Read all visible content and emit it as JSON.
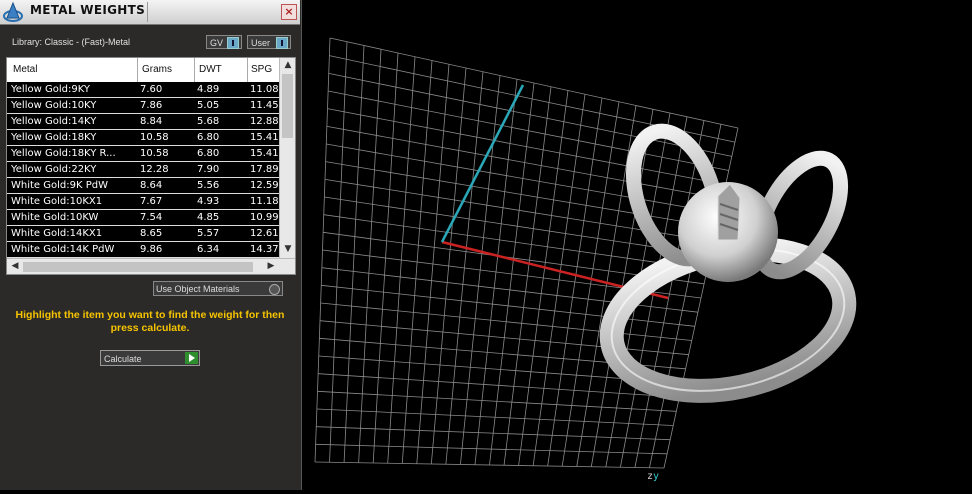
{
  "panel": {
    "title": "METAL WEIGHTS",
    "close": "×",
    "library_label": "Library: Classic - (Fast)-Metal",
    "gv_label": "GV",
    "user_label": "User"
  },
  "table": {
    "columns": [
      "Metal",
      "Grams",
      "DWT",
      "SPG"
    ],
    "rows": [
      {
        "name": "Yellow Gold:9KY",
        "grams": "7.60",
        "dwt": "4.89",
        "spg": "11.08"
      },
      {
        "name": "Yellow Gold:10KY",
        "grams": "7.86",
        "dwt": "5.05",
        "spg": "11.45"
      },
      {
        "name": "Yellow Gold:14KY",
        "grams": "8.84",
        "dwt": "5.68",
        "spg": "12.88"
      },
      {
        "name": "Yellow Gold:18KY",
        "grams": "10.58",
        "dwt": "6.80",
        "spg": "15.41"
      },
      {
        "name": "Yellow Gold:18KY R...",
        "grams": "10.58",
        "dwt": "6.80",
        "spg": "15.41"
      },
      {
        "name": "Yellow Gold:22KY",
        "grams": "12.28",
        "dwt": "7.90",
        "spg": "17.89"
      },
      {
        "name": "White Gold:9K PdW",
        "grams": "8.64",
        "dwt": "5.56",
        "spg": "12.59"
      },
      {
        "name": "White Gold:10KX1",
        "grams": "7.67",
        "dwt": "4.93",
        "spg": "11.18"
      },
      {
        "name": "White Gold:10KW",
        "grams": "7.54",
        "dwt": "4.85",
        "spg": "10.99"
      },
      {
        "name": "White Gold:14KX1",
        "grams": "8.65",
        "dwt": "5.57",
        "spg": "12.61"
      },
      {
        "name": "White Gold:14K PdW",
        "grams": "9.86",
        "dwt": "6.34",
        "spg": "14.37"
      }
    ]
  },
  "use_object_materials": "Use Object Materials",
  "instructions": "Highlight the item you want to find the weight for then press calculate.",
  "calculate_label": "Calculate",
  "viewport": {
    "axis_label_z": "z",
    "axis_label_y": "y"
  },
  "colors": {
    "panel_bg": "#2b2a29",
    "instruction_text": "#f7c400",
    "grid_line": "#8a8a8a",
    "x_axis": "#cc2222",
    "y_axis": "#2aa8b8"
  }
}
